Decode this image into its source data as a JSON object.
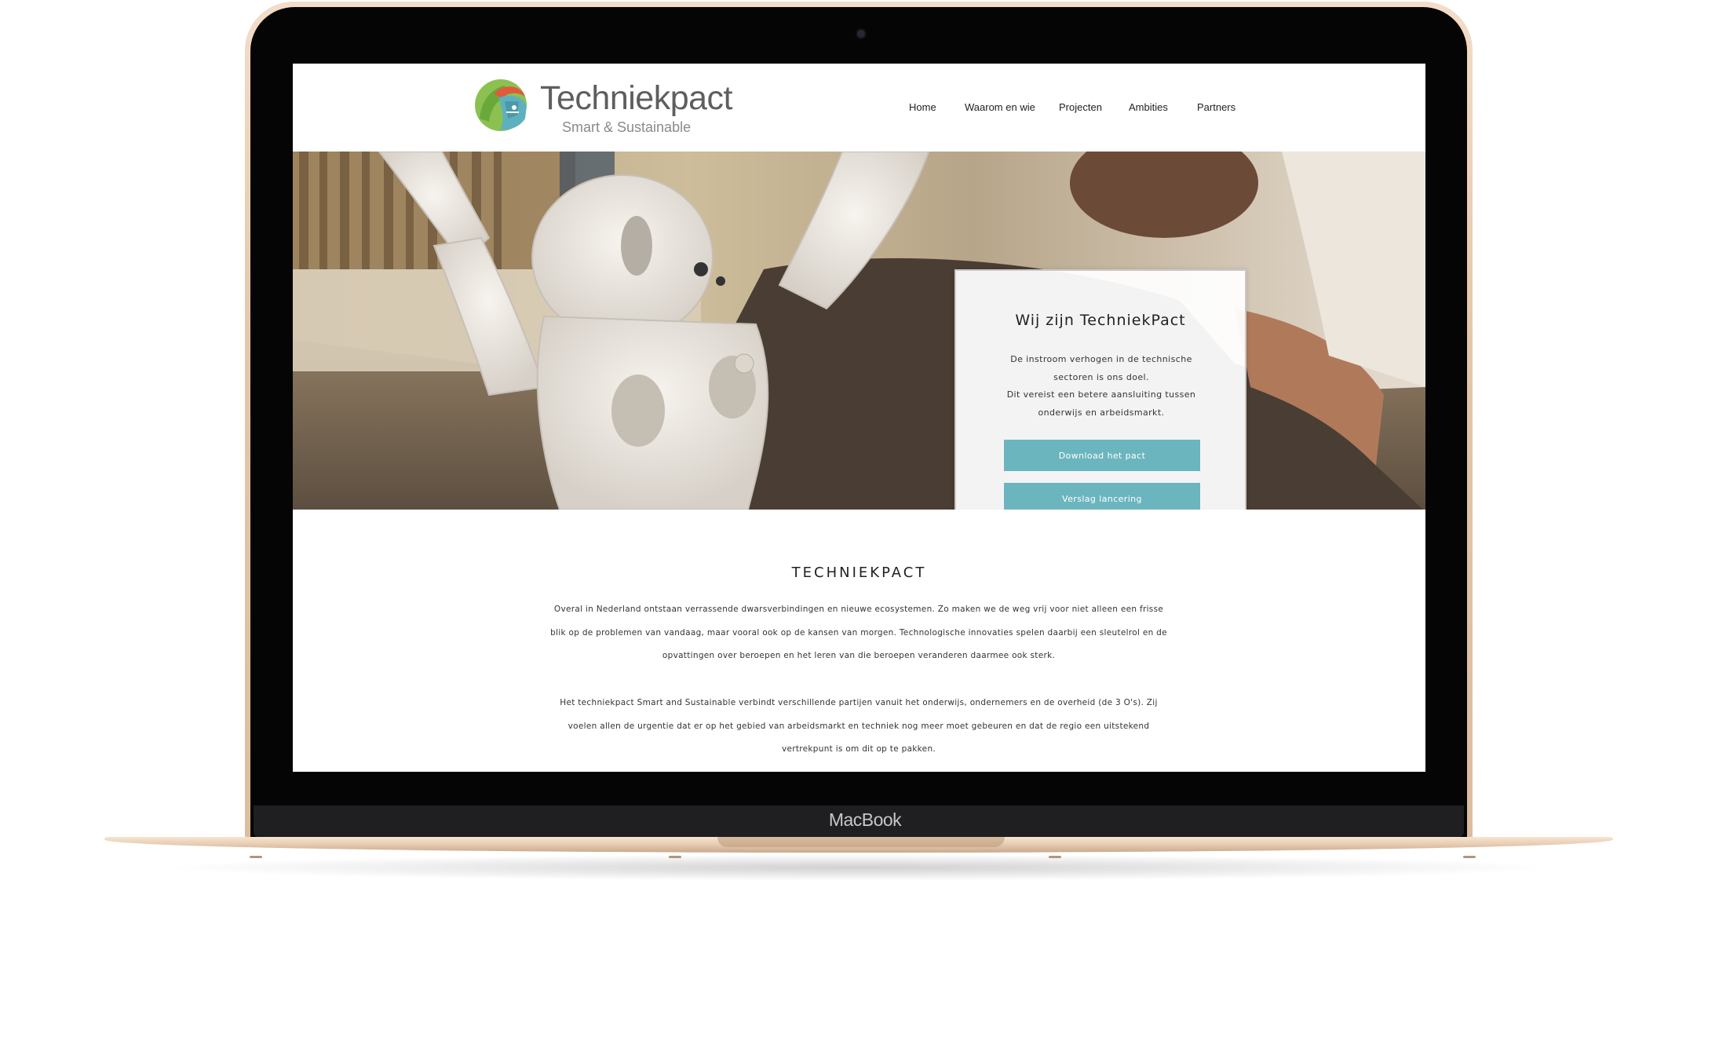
{
  "device": {
    "brand_label": "MacBook"
  },
  "site": {
    "logo_name": "Techniekpact",
    "logo_tagline": "Smart & Sustainable",
    "nav": [
      {
        "label": "Home"
      },
      {
        "label": "Waarom en wie"
      },
      {
        "label": "Projecten"
      },
      {
        "label": "Ambities"
      },
      {
        "label": "Partners"
      }
    ]
  },
  "hero": {
    "card_title": "Wij zijn TechniekPact",
    "card_lines": [
      "De instroom verhogen in de technische",
      "sectoren is ons doel.",
      "Dit vereist een betere aansluiting tussen",
      "onderwijs en arbeidsmarkt."
    ],
    "buttons": [
      {
        "label": "Download het pact"
      },
      {
        "label": "Verslag lancering"
      }
    ],
    "colors": {
      "button": "#6bb5be"
    }
  },
  "content": {
    "title": "TECHNIEKPACT",
    "paragraph1_lines": [
      "Overal in Nederland ontstaan verrassende dwarsverbindingen en nieuwe ecosystemen. Zo maken we de weg vrij voor niet alleen een frisse",
      "blik op de problemen van vandaag, maar vooral ook op de kansen van morgen. Technologische innovaties spelen daarbij een sleutelrol en de",
      "opvattingen over beroepen en het leren van die beroepen veranderen daarmee ook sterk."
    ],
    "paragraph2_lines": [
      "Het techniekpact Smart and Sustainable verbindt verschillende partijen vanuit het onderwijs, ondernemers en de overheid (de 3 O's). Zij",
      "voelen allen de urgentie dat er op het gebied van arbeidsmarkt en techniek nog meer moet gebeuren en dat de regio een uitstekend",
      "vertrekpunt is om dit op te pakken."
    ]
  }
}
